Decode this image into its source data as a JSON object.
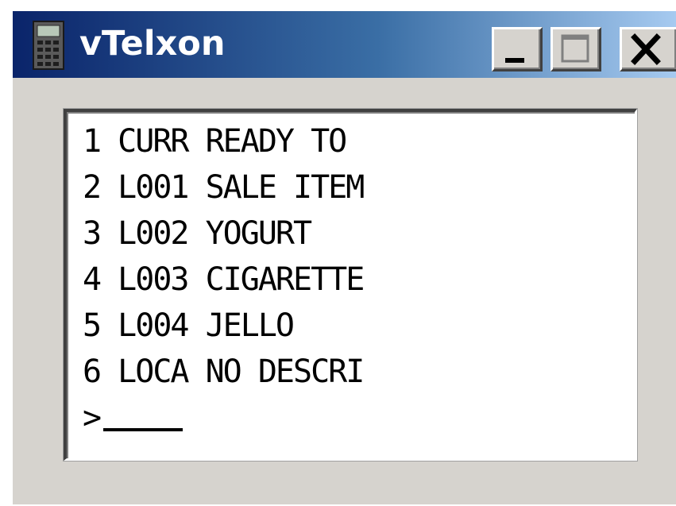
{
  "window": {
    "title": "vTelxon",
    "controls": {
      "minimize": "minimize-icon",
      "maximize": "maximize-icon",
      "close": "close-icon"
    }
  },
  "terminal": {
    "lines": [
      "1 CURR READY TO",
      "2 L001 SALE ITEM",
      "3 L002 YOGURT",
      "4 L003 CIGARETTE",
      "5 L004 JELLO",
      "6 LOCA NO DESCRI"
    ],
    "prompt": ">",
    "input_value": ""
  },
  "colors": {
    "title_gradient_start": "#0a246a",
    "title_gradient_end": "#a6caf0",
    "window_face": "#d6d3ce",
    "screen_bg": "#ffffff"
  }
}
